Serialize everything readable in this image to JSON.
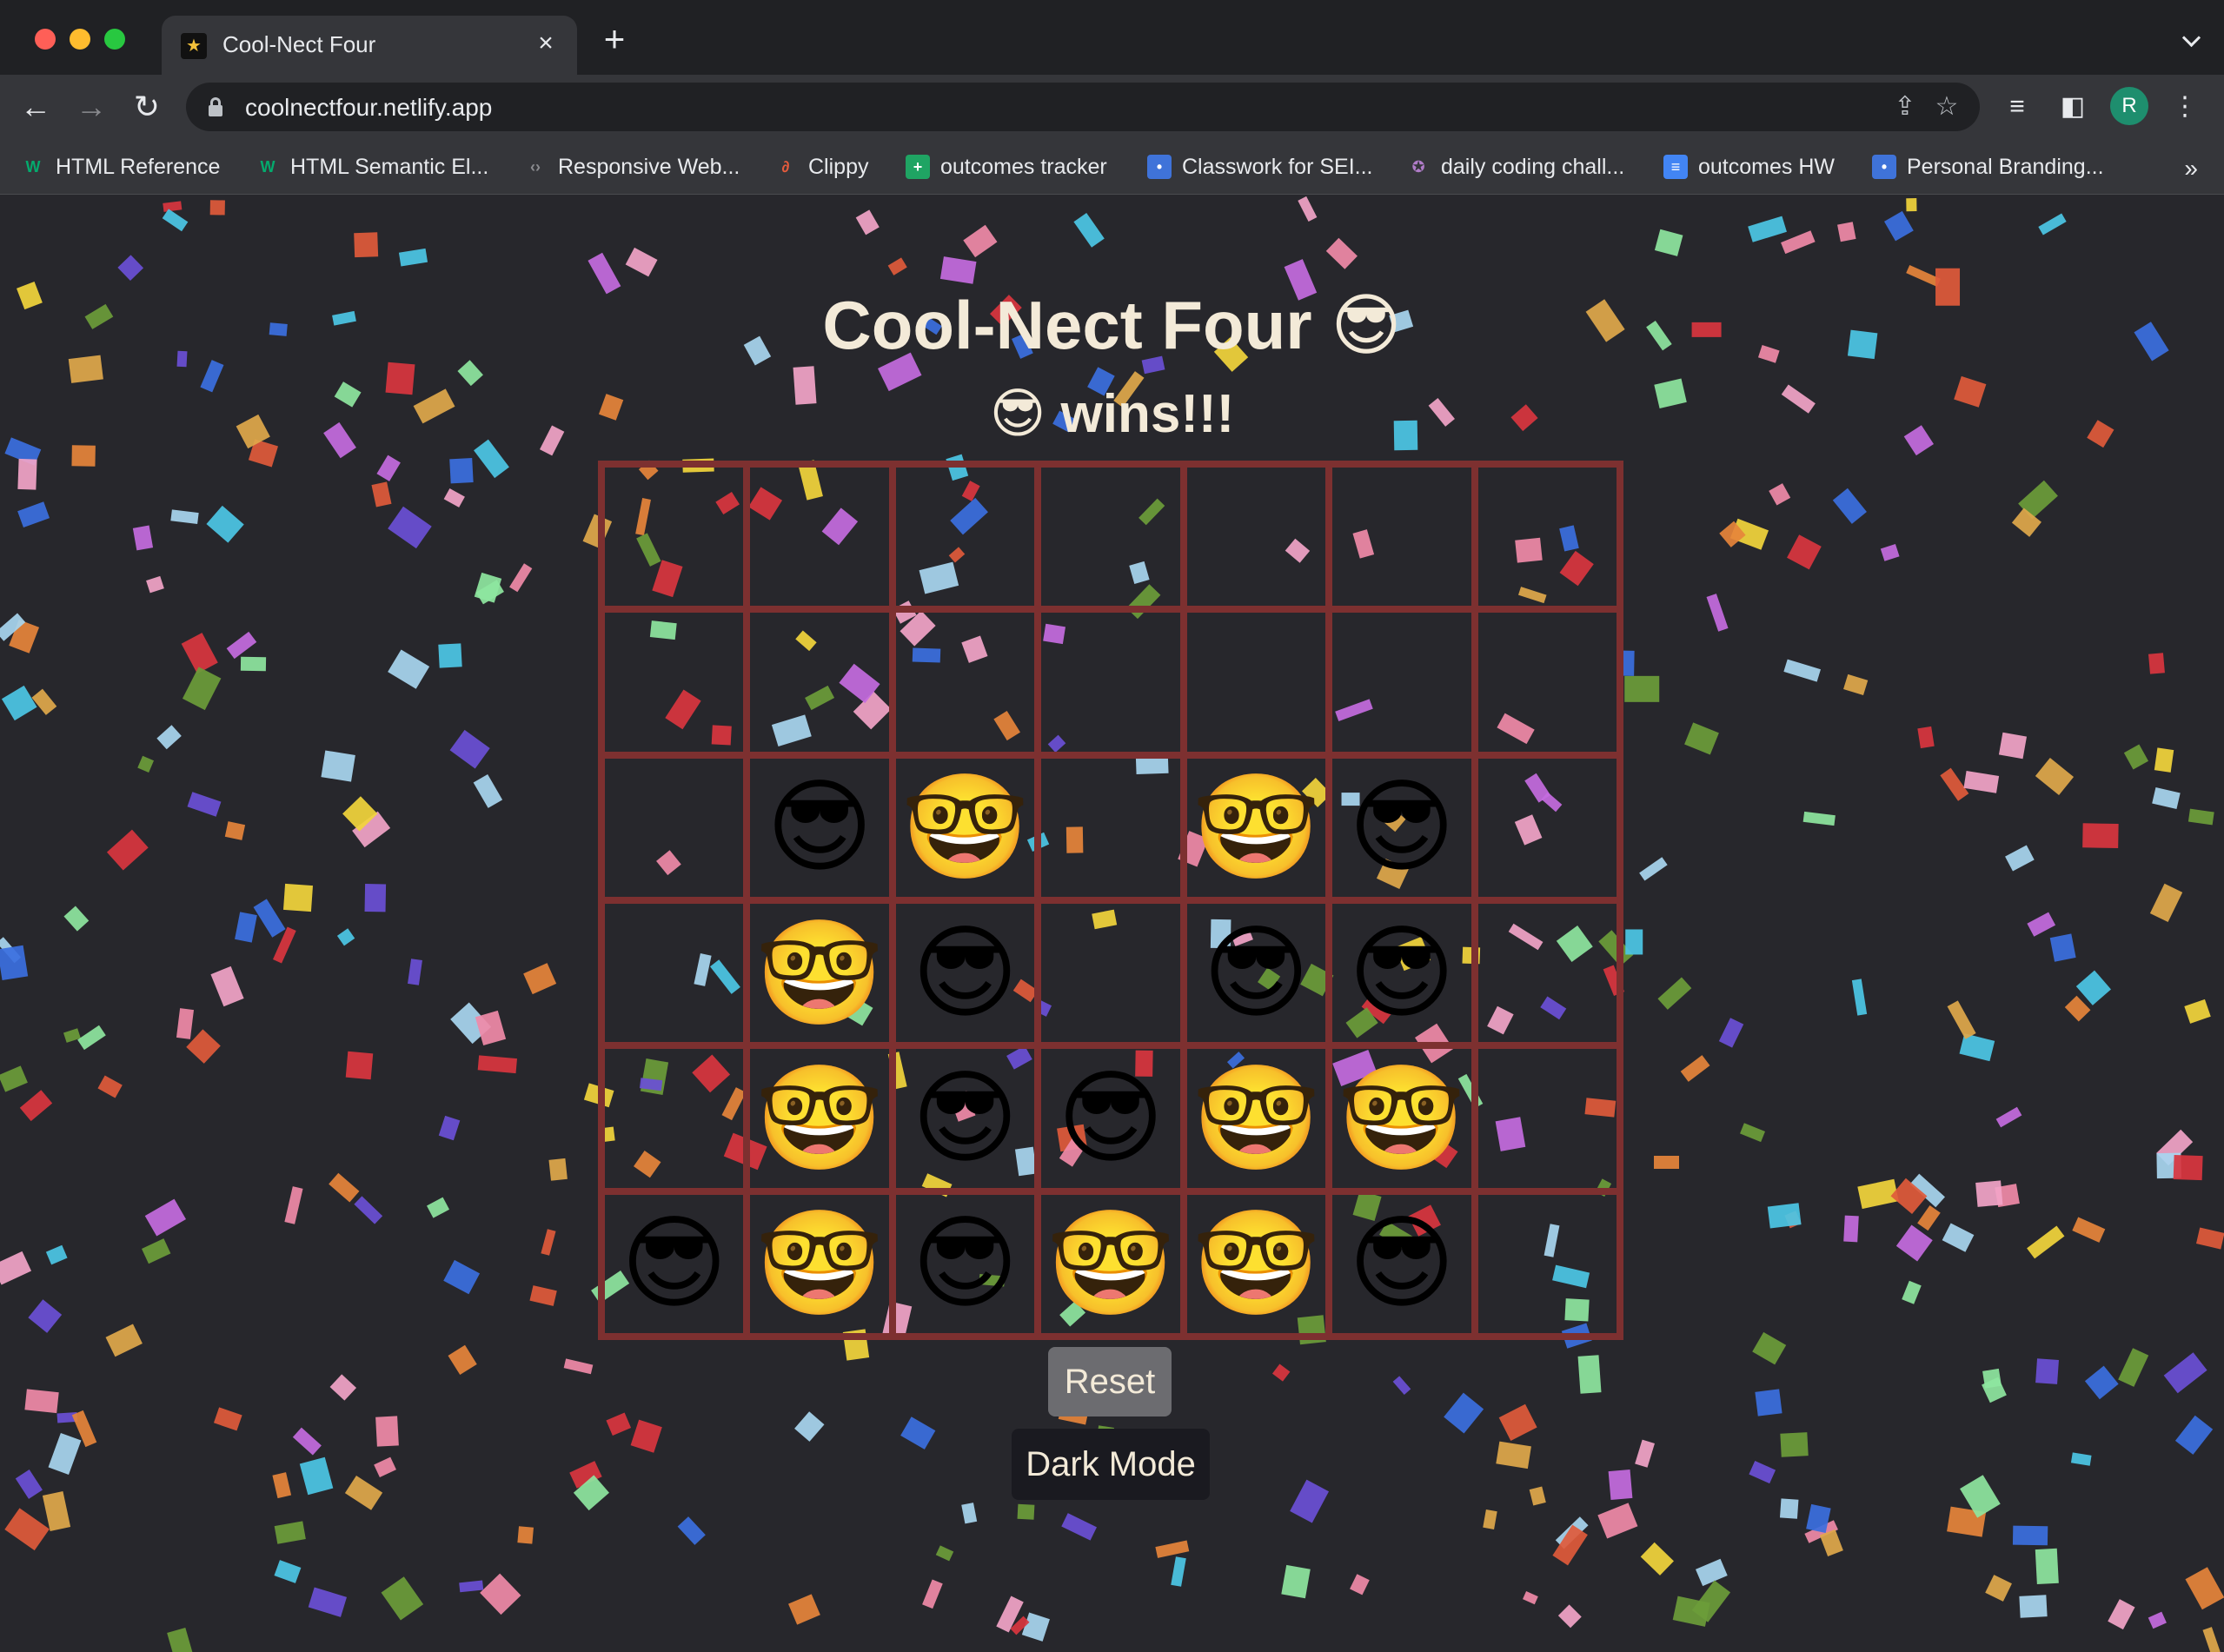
{
  "browser": {
    "tab_title": "Cool-Nect Four",
    "tab_close": "×",
    "new_tab": "+",
    "url": "coolnectfour.netlify.app",
    "avatar_letter": "R",
    "bookmarks": [
      {
        "label": "HTML Reference",
        "icon": "w3-icon",
        "color": "#04aa6d",
        "glyph": "W"
      },
      {
        "label": "HTML Semantic El...",
        "icon": "w3-icon",
        "color": "#04aa6d",
        "glyph": "W"
      },
      {
        "label": "Responsive Web...",
        "icon": "code-icon",
        "color": "#8a8b8f",
        "glyph": "‹›"
      },
      {
        "label": "Clippy",
        "icon": "clippy-icon",
        "color": "#e55b3c",
        "glyph": "∂"
      },
      {
        "label": "outcomes tracker",
        "icon": "sheets-icon",
        "color": "#1fa463",
        "glyph": "+"
      },
      {
        "label": "Classwork for SEI...",
        "icon": "classroom-icon",
        "color": "#3f73d9",
        "glyph": "•"
      },
      {
        "label": "daily coding chall...",
        "icon": "badge-icon",
        "color": "#7c5c8c",
        "glyph": "✪"
      },
      {
        "label": "outcomes HW",
        "icon": "docs-icon",
        "color": "#4285f4",
        "glyph": "≡"
      },
      {
        "label": "Personal Branding...",
        "icon": "classroom-icon",
        "color": "#3f73d9",
        "glyph": "•"
      }
    ],
    "bookmarks_more": "»"
  },
  "game": {
    "title": "Cool-Nect Four 😎",
    "status": "😎 wins!!!",
    "reset_label": "Reset",
    "dark_mode_label": "Dark Mode",
    "pieces": {
      "cool": "😎",
      "nerd": "🤓"
    },
    "board": [
      [
        "",
        "",
        "",
        "",
        "",
        "",
        ""
      ],
      [
        "",
        "",
        "",
        "",
        "",
        "",
        ""
      ],
      [
        "",
        "cool",
        "nerd",
        "",
        "nerd",
        "cool",
        ""
      ],
      [
        "",
        "nerd",
        "cool",
        "",
        "cool",
        "cool",
        ""
      ],
      [
        "",
        "nerd",
        "cool",
        "cool",
        "nerd",
        "nerd",
        ""
      ],
      [
        "cool",
        "nerd",
        "cool",
        "nerd",
        "nerd",
        "cool",
        ""
      ]
    ]
  },
  "colors": {
    "background": "#27272c",
    "board_lines": "#7d3030",
    "text": "#f3ead8",
    "reset_button": "#6c6c70",
    "dark_mode_button": "#1a1a20",
    "confetti": [
      "#3b6fe0",
      "#6a4fd6",
      "#e0a84b",
      "#e05a3b",
      "#8ee6a0",
      "#f2a4c8",
      "#a8d6f0",
      "#f2d53c",
      "#d9353f",
      "#6b9c3a",
      "#e6843b",
      "#c46be0",
      "#f08aa8",
      "#4cc7e6"
    ]
  }
}
